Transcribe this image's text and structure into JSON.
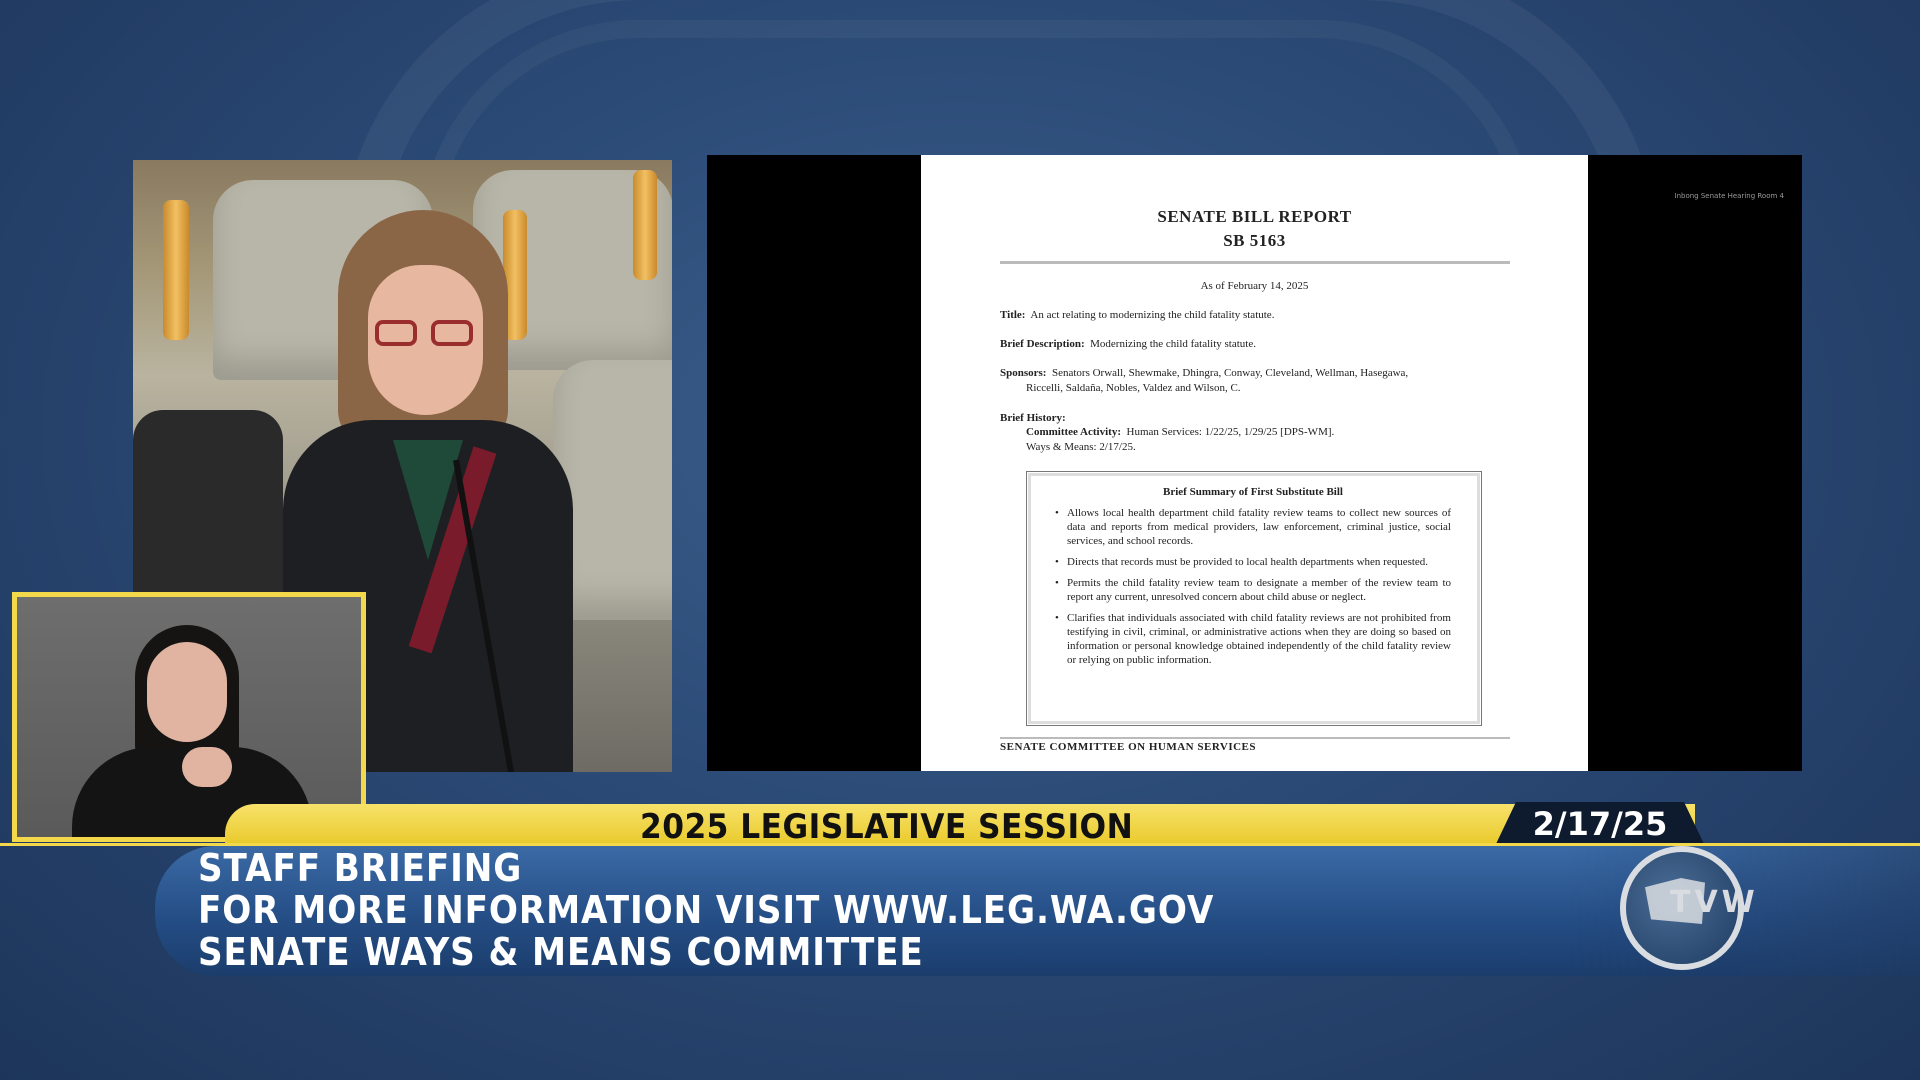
{
  "broadcast": {
    "session_title": "2025 LEGISLATIVE SESSION",
    "date": "2/17/25",
    "lines": [
      "STAFF BRIEFING",
      "FOR MORE INFORMATION VISIT WWW.LEG.WA.GOV",
      "SENATE WAYS & MEANS COMMITTEE"
    ],
    "logo_text": "TVW",
    "accent_color": "#f2d84a",
    "bar_color": "#254e86"
  },
  "display": {
    "corner_tag": "Inbong Senate Hearing Room 4"
  },
  "document": {
    "title1": "SENATE BILL REPORT",
    "title2": "SB 5163",
    "as_of": "As of February 14, 2025",
    "title_label": "Title:",
    "title_text": "An act relating to modernizing the child fatality statute.",
    "brief_label": "Brief Description:",
    "brief_text": "Modernizing the child fatality statute.",
    "sponsors_label": "Sponsors:",
    "sponsors_text1": "Senators Orwall, Shewmake, Dhingra, Conway, Cleveland, Wellman, Hasegawa,",
    "sponsors_text2": "Riccelli, Saldaña, Nobles, Valdez and Wilson, C.",
    "history_label": "Brief History:",
    "committee_label": "Committee Activity:",
    "committee_text1": "Human Services: 1/22/25, 1/29/25 [DPS-WM].",
    "committee_text2": "Ways & Means: 2/17/25.",
    "summary_title": "Brief Summary of First Substitute Bill",
    "summary_items": [
      "Allows local health department child fatality review teams to collect new sources of data and reports from medical providers, law enforcement, criminal justice, social services, and school records.",
      "Directs that records must be provided to local health departments when requested.",
      "Permits the child fatality review team to designate a member of the review team to report any current, unresolved concern about child abuse or neglect.",
      "Clarifies that individuals associated with child fatality reviews are not prohibited from testifying in civil, criminal, or administrative actions when they are doing so based on information or personal knowledge obtained independently of the child fatality review or relying on public information."
    ],
    "footer": "SENATE COMMITTEE ON HUMAN SERVICES"
  }
}
